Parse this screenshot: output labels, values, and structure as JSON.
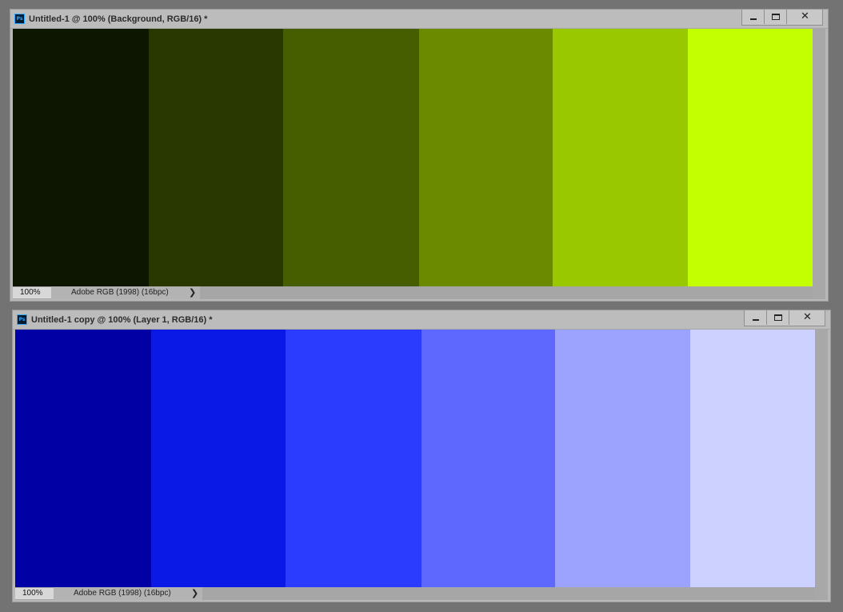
{
  "windows": [
    {
      "title": "Untitled-1 @ 100% (Background, RGB/16) *",
      "app_icon": "Ps",
      "close_glyph": "✕",
      "swatches": [
        {
          "color": "#0c1600",
          "width": 170
        },
        {
          "color": "#283800",
          "width": 168
        },
        {
          "color": "#475e00",
          "width": 170
        },
        {
          "color": "#6c8a00",
          "width": 167
        },
        {
          "color": "#99c800",
          "width": 169
        },
        {
          "color": "#c3ff00",
          "width": 156
        }
      ],
      "status": {
        "zoom": "100%",
        "profile": "Adobe RGB (1998) (16bpc)",
        "arrow": "❯"
      }
    },
    {
      "title": "Untitled-1 copy @ 100% (Layer 1, RGB/16) *",
      "app_icon": "Ps",
      "close_glyph": "✕",
      "swatches": [
        {
          "color": "#0000a4",
          "width": 170
        },
        {
          "color": "#0a19e6",
          "width": 168
        },
        {
          "color": "#2b3cff",
          "width": 170
        },
        {
          "color": "#5e68ff",
          "width": 167
        },
        {
          "color": "#9ba3ff",
          "width": 169
        },
        {
          "color": "#ccd1ff",
          "width": 156
        }
      ],
      "status": {
        "zoom": "100%",
        "profile": "Adobe RGB (1998) (16bpc)",
        "arrow": "❯"
      }
    }
  ]
}
